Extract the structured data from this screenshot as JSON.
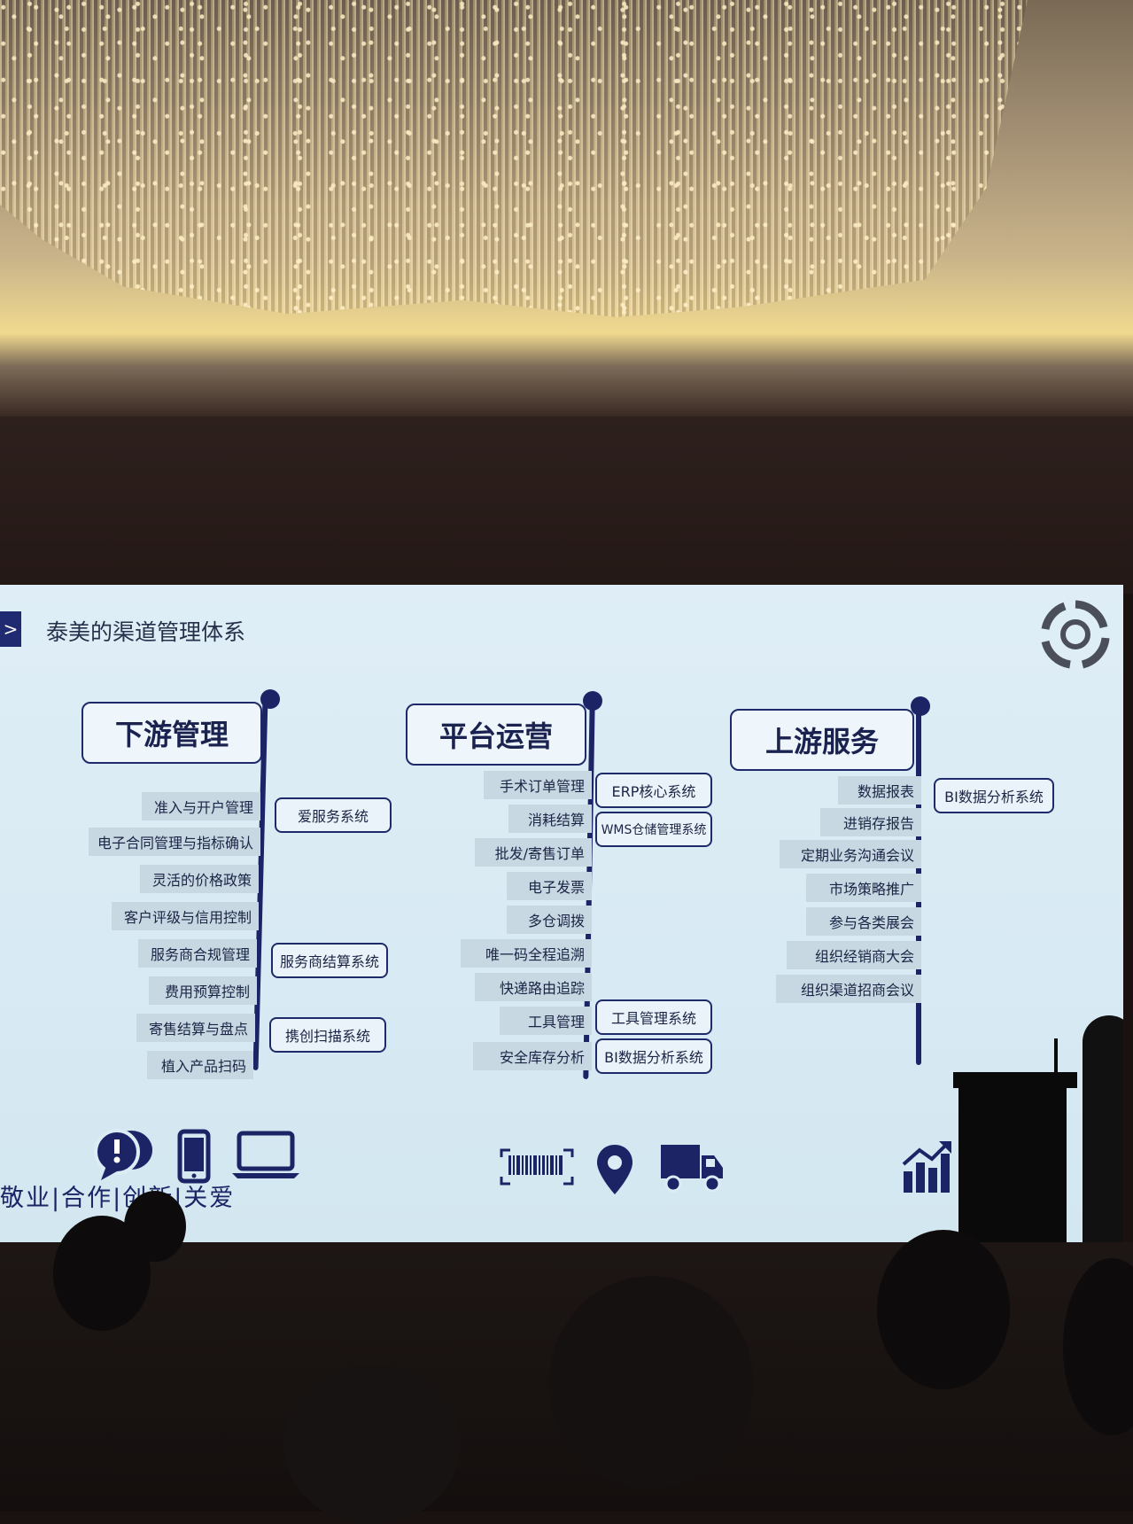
{
  "slide": {
    "title_arrow": ">",
    "title": "泰美的渠道管理体系",
    "columns": [
      {
        "heading": "下游管理",
        "tags": [
          "准入与开户管理",
          "电子合同管理与指标确认",
          "灵活的价格政策",
          "客户评级与信用控制",
          "服务商合规管理",
          "费用预算控制",
          "寄售结算与盘点",
          "植入产品扫码"
        ],
        "systems": [
          "爱服务系统",
          "服务商结算系统",
          "携创扫描系统"
        ]
      },
      {
        "heading": "平台运营",
        "tags": [
          "手术订单管理",
          "消耗结算",
          "批发/寄售订单",
          "电子发票",
          "多仓调拨",
          "唯一码全程追溯",
          "快递路由追踪",
          "工具管理",
          "安全库存分析"
        ],
        "systems": [
          "ERP核心系统",
          "WMS仓储管理系统",
          "工具管理系统",
          "BI数据分析系统"
        ]
      },
      {
        "heading": "上游服务",
        "tags": [
          "数据报表",
          "进销存报告",
          "定期业务沟通会议",
          "市场策略推广",
          "参与各类展会",
          "组织经销商大会",
          "组织渠道招商会议"
        ],
        "systems": [
          "BI数据分析系统"
        ]
      }
    ],
    "slogan": "敬业|合作|创新|关爱",
    "icons": [
      "speech-bubbles-icon",
      "phone-icon",
      "laptop-icon",
      "barcode-icon",
      "location-pin-icon",
      "delivery-truck-icon",
      "growth-chart-icon",
      "company-logo-icon"
    ],
    "colors": {
      "navy": "#1c2466",
      "screen": "#d9ebf4",
      "tag": "#c7d8e3"
    }
  }
}
